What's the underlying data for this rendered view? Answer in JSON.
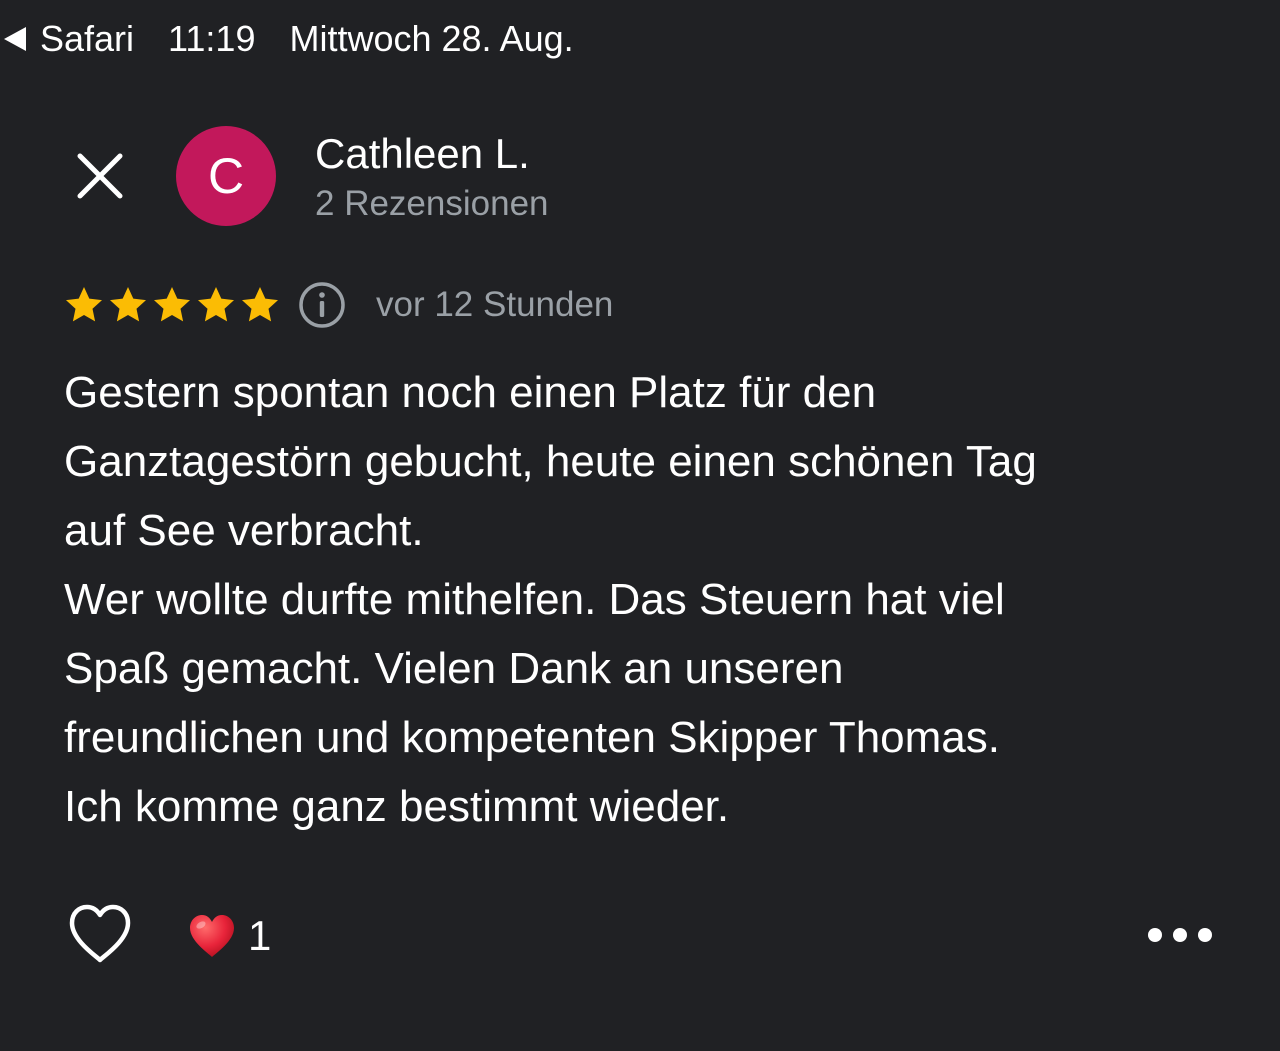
{
  "status_bar": {
    "back_app": "Safari",
    "time": "11:19",
    "date": "Mittwoch 28. Aug."
  },
  "reviewer": {
    "initial": "C",
    "name": "Cathleen L.",
    "review_count": "2 Rezensionen",
    "avatar_color": "#c2185b"
  },
  "review": {
    "rating": 5,
    "max_rating": 5,
    "star_color": "#fbbc04",
    "time_ago": "vor 12 Stunden",
    "lines": [
      "Gestern spontan noch einen Platz für den",
      "Ganztagestörn gebucht, heute einen schönen Tag",
      "auf See verbracht.",
      "Wer wollte durfte mithelfen. Das Steuern hat viel",
      "Spaß gemacht. Vielen Dank an unseren",
      "freundlichen und kompetenten Skipper Thomas.",
      "Ich komme ganz bestimmt wieder."
    ]
  },
  "actions": {
    "like_icon": "heart-outline-icon",
    "reaction_icon": "red-heart-emoji-icon",
    "reaction_count": "1",
    "more_icon": "more-horizontal-icon"
  },
  "colors": {
    "background": "#202124",
    "secondary_text": "#9aa0a6",
    "heart_red": "#e8243a"
  }
}
